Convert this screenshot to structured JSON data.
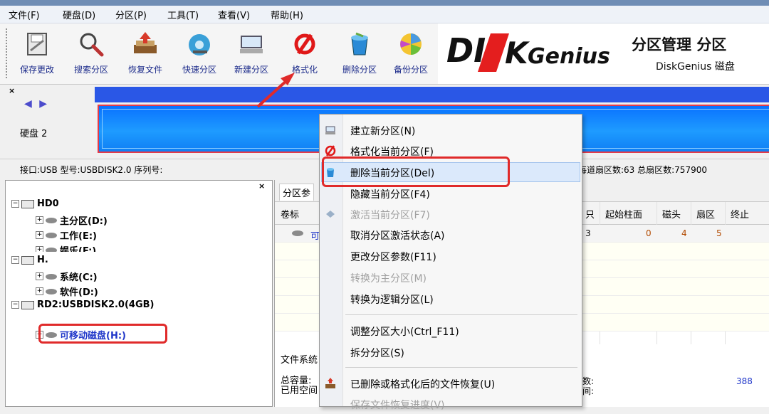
{
  "menubar": {
    "items": [
      "文件(F)",
      "硬盘(D)",
      "分区(P)",
      "工具(T)",
      "查看(V)",
      "帮助(H)"
    ]
  },
  "toolbar": {
    "buttons": [
      {
        "label": "保存更改",
        "icon": "save-icon"
      },
      {
        "label": "搜索分区",
        "icon": "magnifier-icon"
      },
      {
        "label": "恢复文件",
        "icon": "recover-icon"
      },
      {
        "label": "快速分区",
        "icon": "quick-partition-icon"
      },
      {
        "label": "新建分区",
        "icon": "new-partition-icon"
      },
      {
        "label": "格式化",
        "icon": "format-icon"
      },
      {
        "label": "删除分区",
        "icon": "trash-icon"
      },
      {
        "label": "备份分区",
        "icon": "backup-icon"
      }
    ]
  },
  "brand": {
    "logo_text": "DISKGenius",
    "title_cn": "分区管理 分区",
    "subtitle": "DiskGenius 磁盘"
  },
  "diskpanel": {
    "close": "×",
    "nav": "◀ ▶",
    "disk_label": "硬盘 2"
  },
  "infoline": {
    "left": "接口:USB  型号:USBDISK2.0  序列号:",
    "right": "每道扇区数:63  总扇区数:757900"
  },
  "tree": {
    "close": "×",
    "rows": [
      {
        "text": "HD0                    ",
        "type": "disk"
      },
      {
        "text": "主分区(D:)",
        "type": "part"
      },
      {
        "text": "工作(E:)",
        "type": "part"
      },
      {
        "text": "娱乐(F:)",
        "type": "part"
      },
      {
        "text": "H.",
        "type": "disk"
      },
      {
        "text": "系统(C:)",
        "type": "part"
      },
      {
        "text": "软件(D:)",
        "type": "part"
      },
      {
        "text": "RD2:USBDISK2.0(4GB)",
        "type": "disk"
      },
      {
        "text": "可移动磁盘(H:)",
        "type": "part"
      }
    ]
  },
  "rightpanel": {
    "tab": "分区参",
    "columns": [
      "卷标",
      "只",
      "起始柱面",
      "磁头",
      "扇区",
      "终止"
    ],
    "row1": {
      "label": "可",
      "c1": "3",
      "start_cyl": "0",
      "head": "4",
      "sector": "5"
    },
    "fs_label": "文件系统",
    "cap_label": "总容量:\n已用空间",
    "stat_right": "数:\n间:",
    "stat_num": "388"
  },
  "context_menu": {
    "items": [
      {
        "label": "建立新分区(N)",
        "icon": "new-partition-icon",
        "enabled": true
      },
      {
        "label": "格式化当前分区(F)",
        "icon": "format-icon",
        "enabled": true
      },
      {
        "label": "删除当前分区(Del)",
        "icon": "trash-icon",
        "enabled": true,
        "highlighted": true
      },
      {
        "label": "隐藏当前分区(F4)",
        "icon": "",
        "enabled": true
      },
      {
        "label": "激活当前分区(F7)",
        "icon": "activate-icon",
        "enabled": false
      },
      {
        "label": "取消分区激活状态(A)",
        "icon": "",
        "enabled": true
      },
      {
        "label": "更改分区参数(F11)",
        "icon": "",
        "enabled": true
      },
      {
        "label": "转换为主分区(M)",
        "icon": "",
        "enabled": false
      },
      {
        "label": "转换为逻辑分区(L)",
        "icon": "",
        "enabled": true
      },
      {
        "label": "调整分区大小(Ctrl_F11)",
        "icon": "",
        "enabled": true
      },
      {
        "label": "拆分分区(S)",
        "icon": "",
        "enabled": true
      },
      {
        "label": "已删除或格式化后的文件恢复(U)",
        "icon": "recover-icon",
        "enabled": true
      },
      {
        "label": "保存文件恢复进度(V)",
        "icon": "",
        "enabled": false
      }
    ]
  },
  "colors": {
    "annotation_red": "#e02a2a",
    "partition_blue": "#1e9bff",
    "disk_bar_blue": "#2a57e6"
  }
}
